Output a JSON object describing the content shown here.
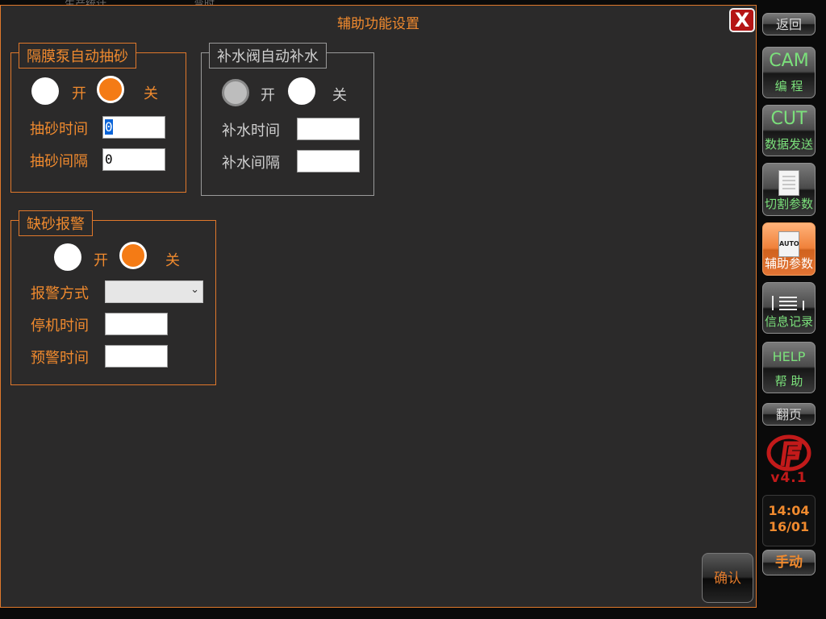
{
  "background": {
    "left_text": "生产统计",
    "mid_text": "弯时"
  },
  "dialog": {
    "title": "辅助功能设置",
    "close_label": "X",
    "confirm_label": "确认"
  },
  "diaphragm_pump": {
    "legend": "隔膜泵自动抽砂",
    "on_label": "开",
    "off_label": "关",
    "selected": "关",
    "fields": [
      {
        "label": "抽砂时间",
        "value": "0"
      },
      {
        "label": "抽砂间隔",
        "value": "0"
      }
    ]
  },
  "water_valve": {
    "legend": "补水阀自动补水",
    "on_label": "开",
    "off_label": "关",
    "fields": [
      {
        "label": "补水时间",
        "value": ""
      },
      {
        "label": "补水间隔",
        "value": ""
      }
    ]
  },
  "sand_alarm": {
    "legend": "缺砂报警",
    "on_label": "开",
    "off_label": "关",
    "selected": "关",
    "alarm_mode_label": "报警方式",
    "alarm_mode_value": "",
    "fields": [
      {
        "label": "停机时间",
        "value": ""
      },
      {
        "label": "预警时间",
        "value": ""
      }
    ]
  },
  "sidebar": {
    "back": "返回",
    "cam": {
      "big": "CAM",
      "small": "编 程"
    },
    "cut": {
      "big": "CUT",
      "small": "数据发送"
    },
    "cutting_params": {
      "small": "切割参数",
      "icon": "document-icon"
    },
    "aux_params": {
      "small": "辅助参数",
      "icon_text": "AUTO"
    },
    "info_log": {
      "small": "信息记录",
      "icon": "list-icon"
    },
    "help": {
      "big": "HELP",
      "small": "帮 助"
    },
    "page_turn": "翻页",
    "version": "v4.1",
    "time": "14:04",
    "date": "16/01",
    "manual": "手动"
  },
  "colors": {
    "accent": "#f08a2e",
    "panel": "#2b2a2a",
    "active_tab": "#f0813a",
    "green_text": "#7be07b"
  }
}
